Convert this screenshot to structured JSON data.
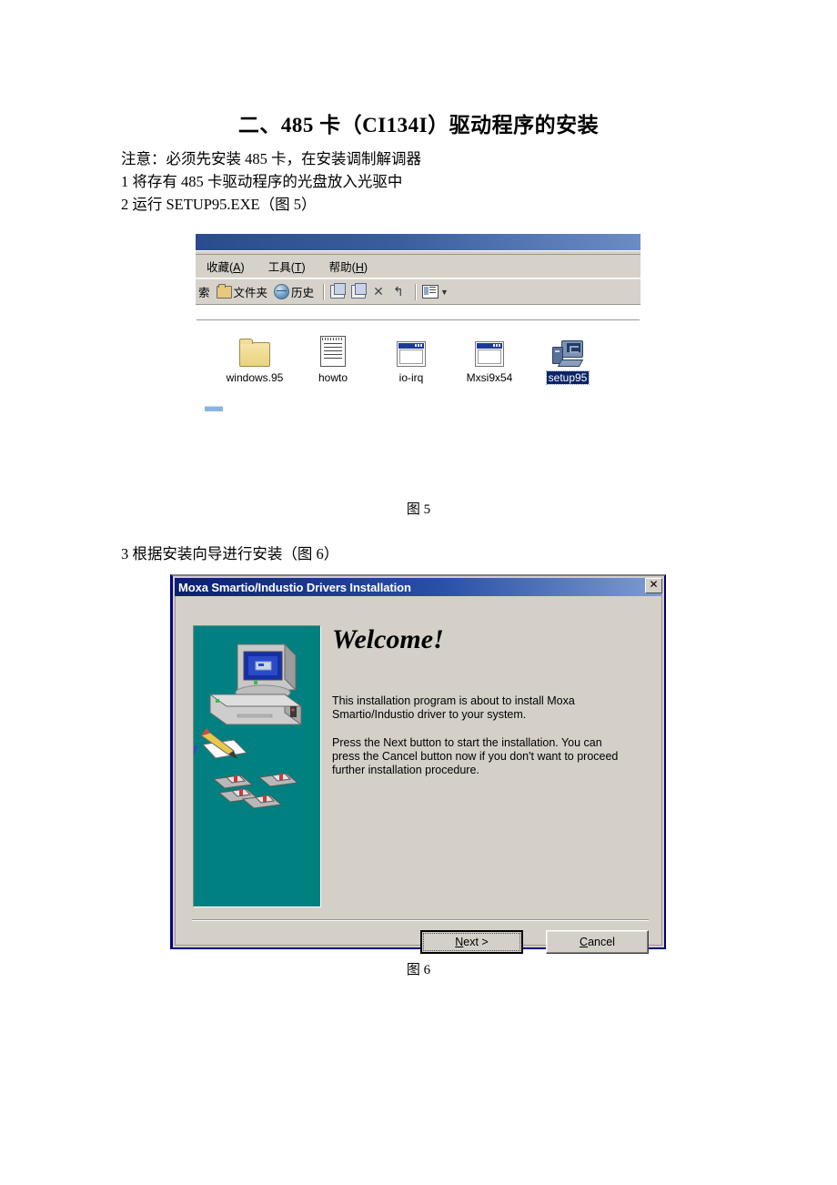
{
  "document": {
    "title": "二、485 卡（CI134I）驱动程序的安装",
    "note": "注意：必须先安装 485 卡，在安装调制解调器",
    "step1": "1  将存有 485 卡驱动程序的光盘放入光驱中",
    "step2": "2  运行 SETUP95.EXE（图 5）",
    "step3": "3  根据安装向导进行安装（图 6）",
    "caption_fig5": "图 5",
    "caption_fig6": "图 6"
  },
  "explorer": {
    "menu": [
      {
        "label": "收藏(A)",
        "accel": "A"
      },
      {
        "label": "工具(T)",
        "accel": "T"
      },
      {
        "label": "帮助(H)",
        "accel": "H"
      }
    ],
    "toolbar": [
      {
        "label": "索",
        "icon": "search-icon"
      },
      {
        "label": "文件夹",
        "icon": "folder-icon"
      },
      {
        "label": "历史",
        "icon": "history-globe-icon"
      },
      {
        "label": "",
        "icon": "move-to-icon"
      },
      {
        "label": "",
        "icon": "copy-to-icon"
      },
      {
        "label": "",
        "icon": "delete-x-icon"
      },
      {
        "label": "",
        "icon": "undo-icon"
      },
      {
        "label": "",
        "icon": "views-icon"
      }
    ],
    "files": [
      {
        "name": "windows.95",
        "icon": "folder-icon",
        "selected": false
      },
      {
        "name": "howto",
        "icon": "text-document-icon",
        "selected": false
      },
      {
        "name": "io-irq",
        "icon": "application-window-icon",
        "selected": false
      },
      {
        "name": "Mxsi9x54",
        "icon": "application-window-icon",
        "selected": false
      },
      {
        "name": "setup95",
        "icon": "setup-computer-icon",
        "selected": true
      }
    ],
    "colors": {
      "titlebar_start": "#2a4c8e",
      "titlebar_end": "#6b8cc4",
      "chrome": "#d6d2ca",
      "selection": "#0a246a"
    }
  },
  "moxa_dialog": {
    "title": "Moxa Smartio/Industio Drivers Installation",
    "close_label": "✕",
    "heading": "Welcome!",
    "paragraph1": "This installation program is about to install Moxa Smartio/Industio driver to your system.",
    "paragraph2": "Press the Next button to start the installation. You can press the Cancel button now if you don't want to proceed further installation procedure.",
    "buttons": [
      {
        "label": "Next >",
        "accel": "N",
        "default": true
      },
      {
        "label": "Cancel",
        "accel": "C",
        "default": false
      }
    ],
    "colors": {
      "titlebar_start": "#0b1f70",
      "titlebar_end": "#7e9bd2",
      "face": "#d4d0c8",
      "art_background": "#008080",
      "border": "#000080"
    }
  }
}
